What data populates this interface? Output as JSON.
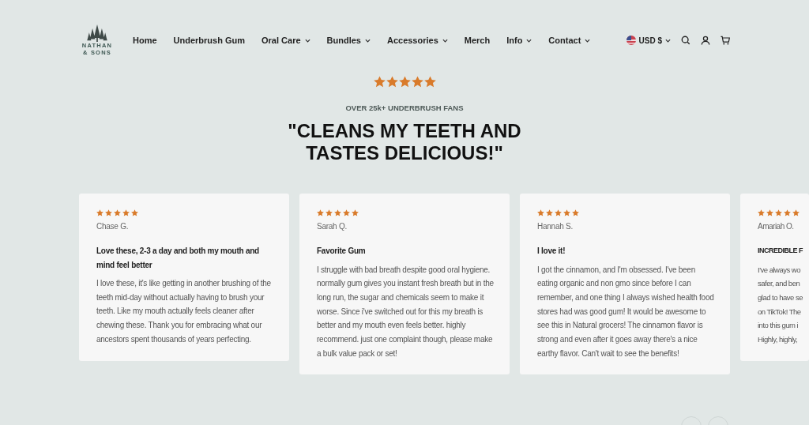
{
  "header": {
    "logo": {
      "line_1": "NATHAN",
      "line_2": "& SONS"
    },
    "nav": [
      {
        "label": "Home",
        "dropdown": false
      },
      {
        "label": "Underbrush Gum",
        "dropdown": false
      },
      {
        "label": "Oral Care",
        "dropdown": true
      },
      {
        "label": "Bundles",
        "dropdown": true
      },
      {
        "label": "Accessories",
        "dropdown": true
      },
      {
        "label": "Merch",
        "dropdown": false
      },
      {
        "label": "Info",
        "dropdown": true
      },
      {
        "label": "Contact",
        "dropdown": true
      }
    ],
    "currency": "USD $"
  },
  "hero": {
    "stars": 5,
    "eyebrow": "OVER 25k+ UNDERBRUSH FANS",
    "headline_1": "\"CLEANS MY TEETH AND",
    "headline_2": "TASTES DELICIOUS!\""
  },
  "reviews": [
    {
      "stars": 5,
      "author": "Chase G.",
      "title": "Love these, 2-3 a day and both my mouth and mind feel better",
      "body": "I love these, it's like getting in another brushing of the teeth mid-day without actually having to brush your teeth. Like my mouth actually feels cleaner after chewing these. Thank you for embracing what our ancestors spent thousands of years perfecting."
    },
    {
      "stars": 5,
      "author": "Sarah Q.",
      "title": "Favorite Gum",
      "body": "I struggle with bad breath despite good oral hygiene. normally gum gives you instant fresh breath but in the long run, the sugar and chemicals seem to make it worse. Since i've switched out for this my breath is better and my mouth even feels better. highly recommend. just one complaint though, please make a bulk value pack or set!"
    },
    {
      "stars": 5,
      "author": "Hannah S.",
      "title": "I love it!",
      "body": "I got the cinnamon, and I'm obsessed. I've been eating organic and non gmo since before I can remember, and one thing I always wished health food stores had was good gum! It would be awesome to see this in Natural grocers! The cinnamon flavor is strong and even after it goes away there's a nice earthy flavor. Can't wait to see the benefits!"
    },
    {
      "stars": 5,
      "author": "Amariah O.",
      "title": "INCREDIBLE F",
      "body_lines": [
        "I've always wo",
        "safer, and ben",
        "glad to have se",
        "on TikTok! The",
        "into this gum i",
        "Highly, highly,"
      ]
    }
  ]
}
